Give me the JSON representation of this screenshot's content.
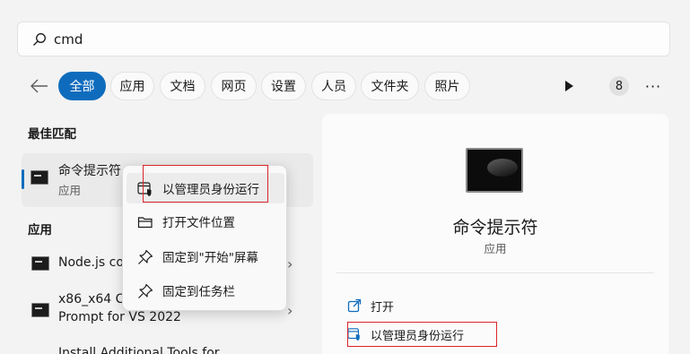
{
  "search": {
    "query": "cmd"
  },
  "filters": {
    "chips": [
      {
        "label": "全部",
        "active": true
      },
      {
        "label": "应用",
        "active": false
      },
      {
        "label": "文档",
        "active": false
      },
      {
        "label": "网页",
        "active": false
      },
      {
        "label": "设置",
        "active": false
      },
      {
        "label": "人员",
        "active": false
      },
      {
        "label": "文件夹",
        "active": false
      },
      {
        "label": "照片",
        "active": false
      }
    ],
    "count": "8",
    "more": "···"
  },
  "best_match": {
    "section_title": "最佳匹配",
    "title": "命令提示符",
    "subtitle": "应用"
  },
  "apps": {
    "section_title": "应用",
    "items": [
      {
        "line1": "Node.js co",
        "line2": ""
      },
      {
        "line1": "x86_x64 Cr",
        "line2": "Prompt for VS 2022"
      },
      {
        "line1": "Install Additional Tools for",
        "line2": ""
      }
    ]
  },
  "context_menu": {
    "items": [
      {
        "label": "以管理员身份运行",
        "icon": "shield-icon"
      },
      {
        "label": "打开文件位置",
        "icon": "folder-icon"
      },
      {
        "label": "固定到\"开始\"屏幕",
        "icon": "pin-icon"
      },
      {
        "label": "固定到任务栏",
        "icon": "pin-icon"
      }
    ]
  },
  "preview": {
    "title": "命令提示符",
    "subtitle": "应用",
    "actions": [
      {
        "label": "打开",
        "icon": "open-icon"
      },
      {
        "label": "以管理员身份运行",
        "icon": "shield-icon"
      }
    ]
  },
  "colors": {
    "accent": "#0f6cbd",
    "highlight_box": "#d9262c"
  }
}
